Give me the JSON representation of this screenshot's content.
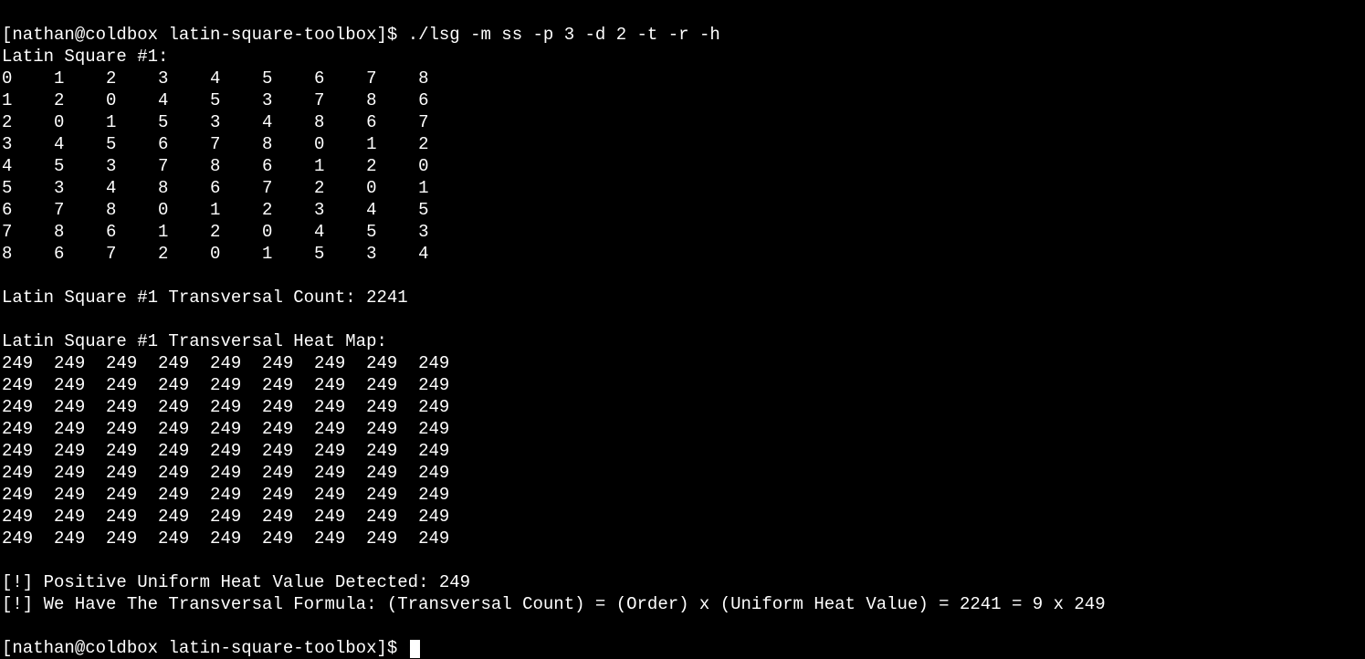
{
  "prompt1": {
    "user_host": "[nathan@coldbox",
    "dir": "latin-square-toolbox]$",
    "command": "./lsg -m ss -p 3 -d 2 -t -r -h"
  },
  "square_header": "Latin Square #1:",
  "square_rows": [
    "0    1    2    3    4    5    6    7    8",
    "1    2    0    4    5    3    7    8    6",
    "2    0    1    5    3    4    8    6    7",
    "3    4    5    6    7    8    0    1    2",
    "4    5    3    7    8    6    1    2    0",
    "5    3    4    8    6    7    2    0    1",
    "6    7    8    0    1    2    3    4    5",
    "7    8    6    1    2    0    4    5    3",
    "8    6    7    2    0    1    5    3    4"
  ],
  "transversal_count": "Latin Square #1 Transversal Count: 2241",
  "heatmap_header": "Latin Square #1 Transversal Heat Map:",
  "heatmap_rows": [
    "249  249  249  249  249  249  249  249  249",
    "249  249  249  249  249  249  249  249  249",
    "249  249  249  249  249  249  249  249  249",
    "249  249  249  249  249  249  249  249  249",
    "249  249  249  249  249  249  249  249  249",
    "249  249  249  249  249  249  249  249  249",
    "249  249  249  249  249  249  249  249  249",
    "249  249  249  249  249  249  249  249  249",
    "249  249  249  249  249  249  249  249  249"
  ],
  "msg1": "[!] Positive Uniform Heat Value Detected: 249",
  "msg2": "[!] We Have The Transversal Formula: (Transversal Count) = (Order) x (Uniform Heat Value) = 2241 = 9 x 249",
  "prompt2": {
    "user_host": "[nathan@coldbox",
    "dir": "latin-square-toolbox]$"
  }
}
